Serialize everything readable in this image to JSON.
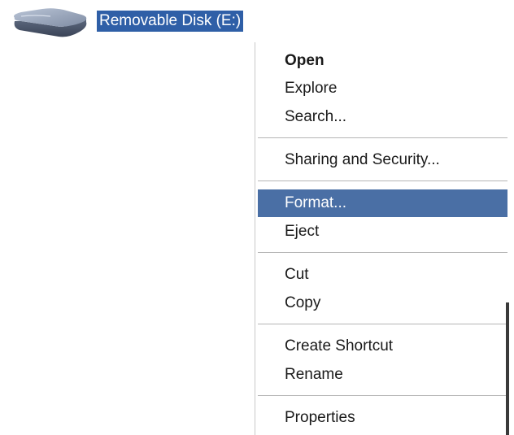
{
  "drive": {
    "icon": "removable-disk-icon",
    "label": "Removable Disk (E:)"
  },
  "context_menu": {
    "items": [
      {
        "label": "Open",
        "bold": true
      },
      {
        "label": "Explore"
      },
      {
        "label": "Search..."
      },
      {
        "label": "Sharing and Security..."
      },
      {
        "label": "Format...",
        "highlighted": true
      },
      {
        "label": "Eject"
      },
      {
        "label": "Cut"
      },
      {
        "label": "Copy"
      },
      {
        "label": "Create Shortcut"
      },
      {
        "label": "Rename"
      },
      {
        "label": "Properties"
      }
    ]
  },
  "colors": {
    "selection": "#2f5fa7",
    "menu_highlight": "#4a6fa5",
    "separator": "#b5b5b5"
  }
}
